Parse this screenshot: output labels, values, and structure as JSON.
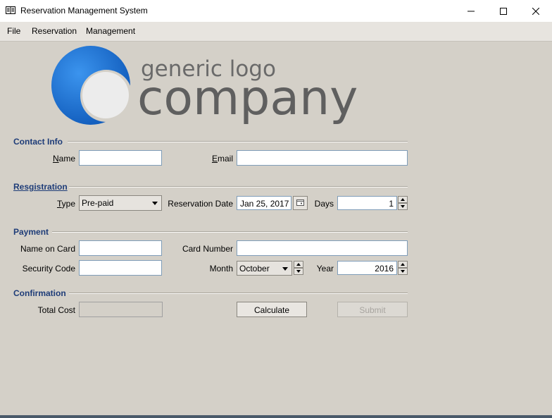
{
  "window": {
    "title": "Reservation Management System"
  },
  "menu": {
    "items": [
      "File",
      "Reservation",
      "Management"
    ]
  },
  "logo": {
    "line1": "generic logo",
    "line2": "company",
    "colors": {
      "circle": "#1a73d6",
      "text": "#606060"
    }
  },
  "sections": {
    "contact": {
      "title": "Contact Info",
      "name_label_u": "N",
      "name_label_rest": "ame",
      "name_value": "",
      "email_label_u": "E",
      "email_label_rest": "mail",
      "email_value": ""
    },
    "registration": {
      "title": "Resgistration",
      "type_label_u": "T",
      "type_label_rest": "ype",
      "type_value": "Pre-paid",
      "date_label": "Reservation Date",
      "date_value": "Jan 25, 2017",
      "days_label": "Days",
      "days_value": "1"
    },
    "payment": {
      "title": "Payment",
      "name_on_card_label": "Name on Card",
      "name_on_card_value": "",
      "card_number_label": "Card Number",
      "card_number_value": "",
      "security_code_label": "Security Code",
      "security_code_value": "",
      "month_label": "Month",
      "month_value": "October",
      "year_label": "Year",
      "year_value": "2016"
    },
    "confirmation": {
      "title": "Confirmation",
      "total_cost_label": "Total Cost",
      "total_cost_value": "",
      "calculate_label": "Calculate",
      "submit_label": "Submit"
    }
  },
  "accent_color": "#1e3c78"
}
